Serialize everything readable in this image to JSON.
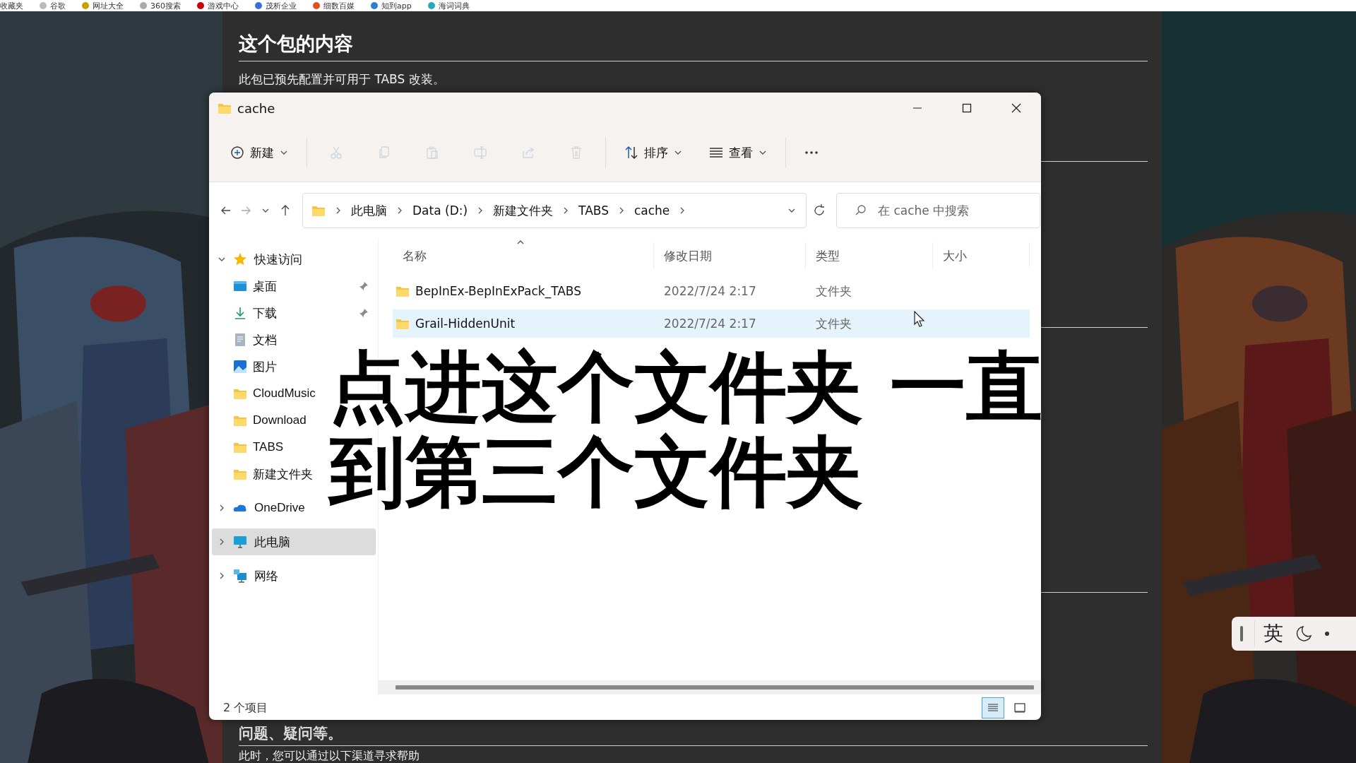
{
  "bookmarks": [
    {
      "label": "收藏夹"
    },
    {
      "label": "谷歌"
    },
    {
      "label": "网址大全"
    },
    {
      "label": "360搜索"
    },
    {
      "label": "游戏中心"
    },
    {
      "label": "茂析企业"
    },
    {
      "label": "细数百媒"
    },
    {
      "label": "知到app"
    },
    {
      "label": "海词词典"
    }
  ],
  "page": {
    "heading": "这个包的内容",
    "intro": "此包已预先配置并可用于 TABS 改装。",
    "section_heading": "问题、疑问等。",
    "help_text": "此时，您可以通过以下渠道寻求帮助"
  },
  "window": {
    "title": "cache"
  },
  "toolbar": [
    {
      "kind": "new",
      "label": "新建",
      "disabled": false
    },
    {
      "kind": "cut",
      "disabled": true
    },
    {
      "kind": "copy",
      "disabled": true
    },
    {
      "kind": "paste",
      "disabled": true
    },
    {
      "kind": "rename",
      "disabled": true
    },
    {
      "kind": "share",
      "disabled": true
    },
    {
      "kind": "delete",
      "disabled": true
    },
    {
      "kind": "sort",
      "label": "排序",
      "disabled": false
    },
    {
      "kind": "view",
      "label": "查看",
      "disabled": false
    },
    {
      "kind": "more",
      "disabled": false
    }
  ],
  "address": {
    "path": [
      "此电脑",
      "Data (D:)",
      "新建文件夹",
      "TABS",
      "cache"
    ],
    "placeholder": "在 cache 中搜索"
  },
  "nav": [
    {
      "kind": "quick",
      "label": "快速访问",
      "expanded": true,
      "selected": false,
      "children": [
        {
          "kind": "desktop",
          "label": "桌面",
          "pinned": true,
          "selected": false
        },
        {
          "kind": "downloads",
          "label": "下载",
          "pinned": true,
          "selected": false
        },
        {
          "kind": "documents",
          "label": "文档",
          "pinned": false,
          "selected": false
        },
        {
          "kind": "pictures",
          "label": "图片",
          "pinned": false,
          "selected": false
        },
        {
          "kind": "folder",
          "label": "CloudMusic",
          "pinned": false,
          "selected": false
        },
        {
          "kind": "folder",
          "label": "Download",
          "pinned": false,
          "selected": false
        },
        {
          "kind": "folder",
          "label": "TABS",
          "pinned": false,
          "selected": false
        },
        {
          "kind": "folder",
          "label": "新建文件夹",
          "pinned": false,
          "selected": false
        }
      ]
    },
    {
      "kind": "onedrive",
      "label": "OneDrive",
      "expanded": false,
      "selected": false
    },
    {
      "kind": "pc",
      "label": "此电脑",
      "expanded": false,
      "selected": true
    },
    {
      "kind": "network",
      "label": "网络",
      "expanded": false,
      "selected": false
    }
  ],
  "columns": [
    {
      "label": "名称",
      "sorted": true
    },
    {
      "label": "修改日期",
      "sorted": false
    },
    {
      "label": "类型",
      "sorted": false
    },
    {
      "label": "大小",
      "sorted": false
    }
  ],
  "files": [
    {
      "name": "BepInEx-BepInExPack_TABS",
      "modified": "2022/7/24 2:17",
      "type": "文件夹",
      "selected": false
    },
    {
      "name": "Grail-HiddenUnit",
      "modified": "2022/7/24 2:17",
      "type": "文件夹",
      "selected": true
    }
  ],
  "status": {
    "count": "2 个项目"
  },
  "view_buttons": [
    {
      "kind": "details",
      "selected": true
    },
    {
      "kind": "tiles",
      "selected": false
    }
  ],
  "caption": [
    "点进这个文件夹 一直",
    "到第三个文件夹"
  ],
  "ime": {
    "mode": "英"
  }
}
